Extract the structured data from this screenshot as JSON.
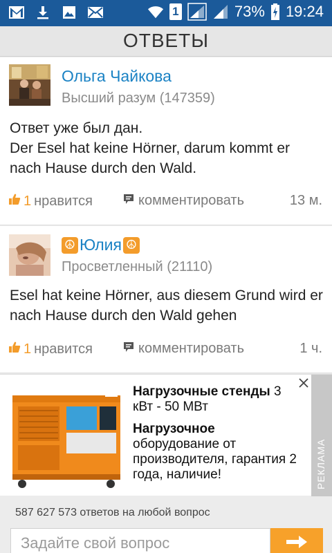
{
  "status_bar": {
    "battery": "73%",
    "time": "19:24",
    "sim_label": "1",
    "left_icons": [
      "gmail-icon",
      "download-icon",
      "gallery-icon",
      "mail-icon"
    ],
    "right_icons": [
      "wifi-icon",
      "sim-1-icon",
      "signal-icon",
      "signal-icon",
      "battery-charging-icon"
    ]
  },
  "header": {
    "title": "ОТВЕТЫ"
  },
  "answers": [
    {
      "author": "Ольга Чайкова",
      "rank": "Высший разум (147359)",
      "text_line1": "Ответ уже был дан.",
      "text_line2": "Der Esel hat keine Hörner, darum kommt er nach Hause durch den Wald.",
      "likes": "1",
      "like_label": "нравится",
      "comment_label": "комментировать",
      "time": "13 м."
    },
    {
      "author": "Юлия",
      "rank": "Просветленный (21110)",
      "text": "Esel hat keine Hörner, aus diesem Grund wird er nach Hause durch den Wald gehen",
      "likes": "1",
      "like_label": "нравится",
      "comment_label": "комментировать",
      "time": "1 ч."
    }
  ],
  "ad": {
    "title_bold": "Нагрузочные стенды",
    "title_rest": " 3 кВт - 50 МВт",
    "body_bold": "Нагрузочное",
    "body_rest": " оборудование от производителя, гарантия 2 года, наличие!",
    "label": "РЕКЛАМА"
  },
  "footer": {
    "count_text": "587 627 573 ответов на любой вопрос",
    "question_placeholder": "Задайте свой вопрос"
  },
  "colors": {
    "status_bar": "#1b5a9a",
    "link": "#1a82c4",
    "accent": "#f39c2b",
    "submit": "#f7a12a"
  }
}
